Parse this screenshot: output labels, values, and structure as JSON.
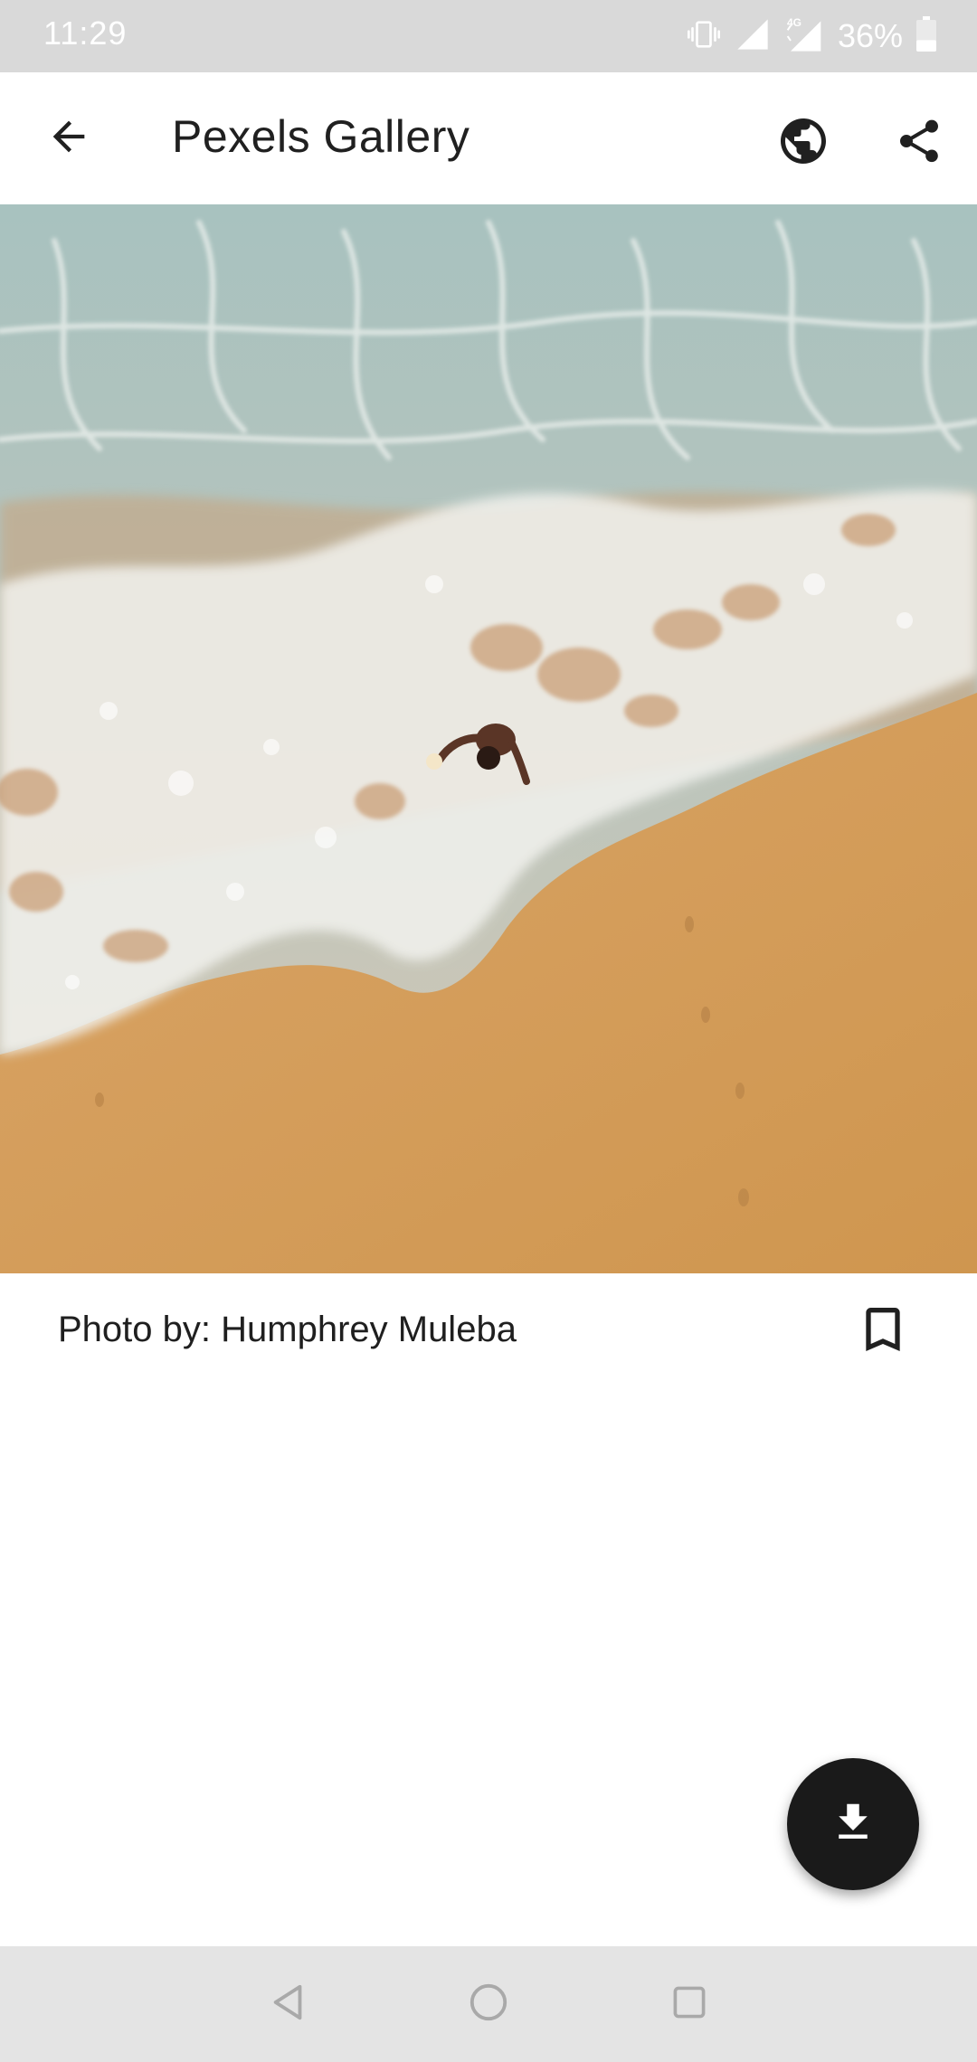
{
  "status_bar": {
    "time": "11:29",
    "battery_percent": "36%",
    "network_label": "4G",
    "battery_level": 0.36
  },
  "app_bar": {
    "title": "Pexels Gallery",
    "back_icon": "arrow-back-icon",
    "globe_icon": "globe-icon",
    "share_icon": "share-icon"
  },
  "photo": {
    "caption": "Photo by: Humphrey Muleba",
    "bookmark_icon": "bookmark-outline-icon"
  },
  "fab": {
    "icon": "download-icon"
  },
  "nav_bar": {
    "back_icon": "nav-back-icon",
    "home_icon": "nav-home-icon",
    "recents_icon": "nav-recents-icon"
  },
  "colors": {
    "status_bar_bg": "#d9d9d9",
    "app_bar_bg": "#ffffff",
    "fab_bg": "#1a1a1a",
    "nav_bar_bg": "#e4e4e4",
    "sand": "#d29a5a",
    "sea": "#a9bfb9"
  }
}
